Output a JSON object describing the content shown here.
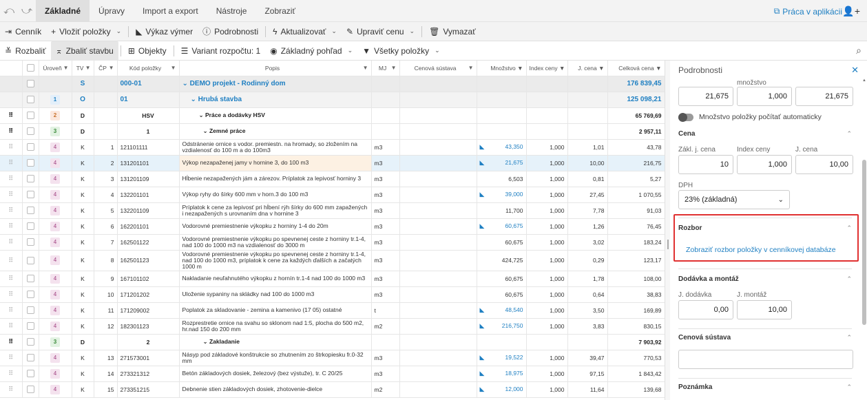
{
  "menu": {
    "tabs": [
      "Základné",
      "Úpravy",
      "Import a export",
      "Nástroje",
      "Zobraziť"
    ],
    "praca": "Práca v aplikácii"
  },
  "toolbar1": {
    "cennik": "Cenník",
    "vlozit": "Vložiť položky",
    "vykaz": "Výkaz výmer",
    "podrobnosti": "Podrobnosti",
    "aktualizovat": "Aktualizovať",
    "upravit": "Upraviť cenu",
    "vymazat": "Vymazať"
  },
  "toolbar2": {
    "rozbalit": "Rozbaliť",
    "zbalit": "Zbaliť stavbu",
    "objekty": "Objekty",
    "variant": "Variant rozpočtu: 1",
    "pohlad": "Základný pohľad",
    "polozky": "Všetky položky"
  },
  "grid": {
    "headers": [
      "Úroveň",
      "TV",
      "ČP",
      "Kód položky",
      "Popis",
      "MJ",
      "Cenová sústava",
      "Množstvo",
      "Index ceny",
      "J. cena",
      "Celková cena"
    ],
    "rows": [
      {
        "type": "s",
        "lvl": "",
        "tv": "S",
        "cp": "",
        "kod": "000-01",
        "popis": "DEMO projekt - Rodinný dom",
        "mj": "",
        "mn": "",
        "idx": "",
        "jc": "",
        "cc": "176 839,45",
        "flag": false
      },
      {
        "type": "o",
        "lvl": "1",
        "tv": "O",
        "cp": "",
        "kod": "01",
        "popis": "Hrubá stavba",
        "mj": "",
        "mn": "",
        "idx": "",
        "jc": "",
        "cc": "125 098,21",
        "flag": false
      },
      {
        "type": "d",
        "lvl": "2",
        "tv": "D",
        "cp": "",
        "kod": "HSV",
        "popis": "Práce a dodávky HSV",
        "mj": "",
        "mn": "",
        "idx": "",
        "jc": "",
        "cc": "65 769,69",
        "flag": false
      },
      {
        "type": "d",
        "lvl": "3",
        "tv": "D",
        "cp": "",
        "kod": "1",
        "popis": "Zemné práce",
        "mj": "",
        "mn": "",
        "idx": "",
        "jc": "",
        "cc": "2 957,11",
        "flag": false
      },
      {
        "type": "k",
        "lvl": "4",
        "tv": "K",
        "cp": "1",
        "kod": "121101111",
        "popis": "Odstránenie ornice s vodor. premiestn. na hromady, so zložením na vzdialenosť do 100 m a do 100m3",
        "mj": "m3",
        "mn": "43,350",
        "idx": "1,000",
        "jc": "1,01",
        "cc": "43,78",
        "flag": true
      },
      {
        "type": "sel",
        "lvl": "4",
        "tv": "K",
        "cp": "2",
        "kod": "131201101",
        "popis": "Výkop nezapaženej jamy v hornine 3, do 100 m3",
        "mj": "m3",
        "mn": "21,675",
        "idx": "1,000",
        "jc": "10,00",
        "cc": "216,75",
        "flag": true
      },
      {
        "type": "k",
        "lvl": "4",
        "tv": "K",
        "cp": "3",
        "kod": "131201109",
        "popis": "Hĺbenie nezapažených jám a zárezov. Príplatok za lepivosť horniny 3",
        "mj": "m3",
        "mn": "6,503",
        "idx": "1,000",
        "jc": "0,81",
        "cc": "5,27",
        "flag": false
      },
      {
        "type": "k",
        "lvl": "4",
        "tv": "K",
        "cp": "4",
        "kod": "132201101",
        "popis": "Výkop ryhy do šírky 600 mm v horn.3 do 100 m3",
        "mj": "m3",
        "mn": "39,000",
        "idx": "1,000",
        "jc": "27,45",
        "cc": "1 070,55",
        "flag": true
      },
      {
        "type": "k",
        "lvl": "4",
        "tv": "K",
        "cp": "5",
        "kod": "132201109",
        "popis": "Príplatok k cene za lepivosť pri hĺbení rýh šírky do 600 mm zapažených i nezapažených s urovnaním dna v hornine 3",
        "mj": "m3",
        "mn": "11,700",
        "idx": "1,000",
        "jc": "7,78",
        "cc": "91,03",
        "flag": false
      },
      {
        "type": "k",
        "lvl": "4",
        "tv": "K",
        "cp": "6",
        "kod": "162201101",
        "popis": "Vodorovné premiestnenie výkopku z horniny 1-4 do 20m",
        "mj": "m3",
        "mn": "60,675",
        "idx": "1,000",
        "jc": "1,26",
        "cc": "76,45",
        "flag": true
      },
      {
        "type": "k",
        "lvl": "4",
        "tv": "K",
        "cp": "7",
        "kod": "162501122",
        "popis": "Vodorovné premiestnenie výkopku po spevnenej ceste z horniny tr.1-4, nad 100 do 1000 m3 na vzdialenosť do 3000 m",
        "mj": "m3",
        "mn": "60,675",
        "idx": "1,000",
        "jc": "3,02",
        "cc": "183,24",
        "flag": false
      },
      {
        "type": "k3",
        "lvl": "4",
        "tv": "K",
        "cp": "8",
        "kod": "162501123",
        "popis": "Vodorovné premiestnenie výkopku po spevnenej ceste z horniny tr.1-4, nad 100 do 1000 m3, príplatok k cene za každých ďalších a začatých 1000 m",
        "mj": "m3",
        "mn": "424,725",
        "idx": "1,000",
        "jc": "0,29",
        "cc": "123,17",
        "flag": false
      },
      {
        "type": "k",
        "lvl": "4",
        "tv": "K",
        "cp": "9",
        "kod": "167101102",
        "popis": "Nakladanie neuľahnutého výkopku z hornín tr.1-4 nad 100 do 1000 m3",
        "mj": "m3",
        "mn": "60,675",
        "idx": "1,000",
        "jc": "1,78",
        "cc": "108,00",
        "flag": false
      },
      {
        "type": "k",
        "lvl": "4",
        "tv": "K",
        "cp": "10",
        "kod": "171201202",
        "popis": "Uloženie sypaniny na skládky nad 100 do 1000 m3",
        "mj": "m3",
        "mn": "60,675",
        "idx": "1,000",
        "jc": "0,64",
        "cc": "38,83",
        "flag": false
      },
      {
        "type": "k",
        "lvl": "4",
        "tv": "K",
        "cp": "11",
        "kod": "171209002",
        "popis": "Poplatok za skladovanie - zemina a kamenivo (17 05) ostatné",
        "mj": "t",
        "mn": "48,540",
        "idx": "1,000",
        "jc": "3,50",
        "cc": "169,89",
        "flag": true
      },
      {
        "type": "k",
        "lvl": "4",
        "tv": "K",
        "cp": "12",
        "kod": "182301123",
        "popis": "Rozprestretie ornice na svahu so sklonom nad 1:5, plocha do 500 m2, hr.nad 150 do 200 mm",
        "mj": "m2",
        "mn": "216,750",
        "idx": "1,000",
        "jc": "3,83",
        "cc": "830,15",
        "flag": true
      },
      {
        "type": "d",
        "lvl": "3",
        "tv": "D",
        "cp": "",
        "kod": "2",
        "popis": "Zakladanie",
        "mj": "",
        "mn": "",
        "idx": "",
        "jc": "",
        "cc": "7 903,92",
        "flag": false
      },
      {
        "type": "k",
        "lvl": "4",
        "tv": "K",
        "cp": "13",
        "kod": "271573001",
        "popis": "Násyp pod základové konštrukcie so zhutnením zo štrkopiesku fr.0-32 mm",
        "mj": "m3",
        "mn": "19,522",
        "idx": "1,000",
        "jc": "39,47",
        "cc": "770,53",
        "flag": true
      },
      {
        "type": "k",
        "lvl": "4",
        "tv": "K",
        "cp": "14",
        "kod": "273321312",
        "popis": "Betón základových dosiek, železový (bez výstuže), tr. C 20/25",
        "mj": "m3",
        "mn": "18,975",
        "idx": "1,000",
        "jc": "97,15",
        "cc": "1 843,42",
        "flag": true
      },
      {
        "type": "k",
        "lvl": "4",
        "tv": "K",
        "cp": "15",
        "kod": "273351215",
        "popis": "Debnenie stien základových dosiek, zhotovenie-dielce",
        "mj": "m2",
        "mn": "12,000",
        "idx": "1,000",
        "jc": "11,64",
        "cc": "139,68",
        "flag": true
      }
    ]
  },
  "panel": {
    "title": "Podrobnosti",
    "mnozstvo_label": "množstvo",
    "m1": "21,675",
    "m2": "1,000",
    "m3": "21,675",
    "auto": "Množstvo položky počítať automaticky",
    "cena": "Cena",
    "zakl": "Zákl. j. cena",
    "index": "Index ceny",
    "jcena": "J. cena",
    "v_zakl": "10",
    "v_index": "1,000",
    "v_jcena": "10,00",
    "dph": "DPH",
    "dph_val": "23% (základná)",
    "rozbor": "Rozbor",
    "rozbor_link": "Zobraziť rozbor položky v cenníkovej databáze",
    "dodavka": "Dodávka a montáž",
    "jdod": "J. dodávka",
    "jmont": "J. montáž",
    "v_jdod": "0,00",
    "v_jmont": "10,00",
    "sustava": "Cenová sústava",
    "poznamka": "Poznámka"
  }
}
